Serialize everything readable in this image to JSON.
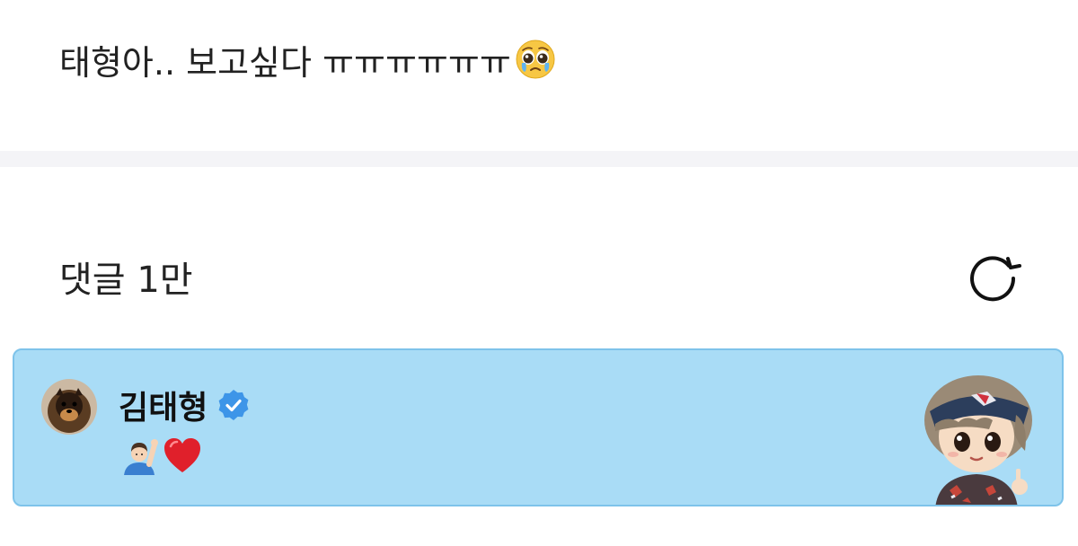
{
  "post": {
    "text": "태형아.. 보고싶다 ㅠㅠㅠㅠㅠㅠ",
    "trailing_emoji": "pleading-face-with-tears"
  },
  "comments": {
    "header": "댓글 1만",
    "refresh_icon": "refresh-icon"
  },
  "pinned_comment": {
    "author": "김태형",
    "verified": true,
    "body_emojis": [
      "person-raising-hand",
      "red-heart"
    ],
    "highlight_color": "#a9dcf6",
    "border_color": "#7ec3ea",
    "verified_color": "#3d95e8"
  }
}
